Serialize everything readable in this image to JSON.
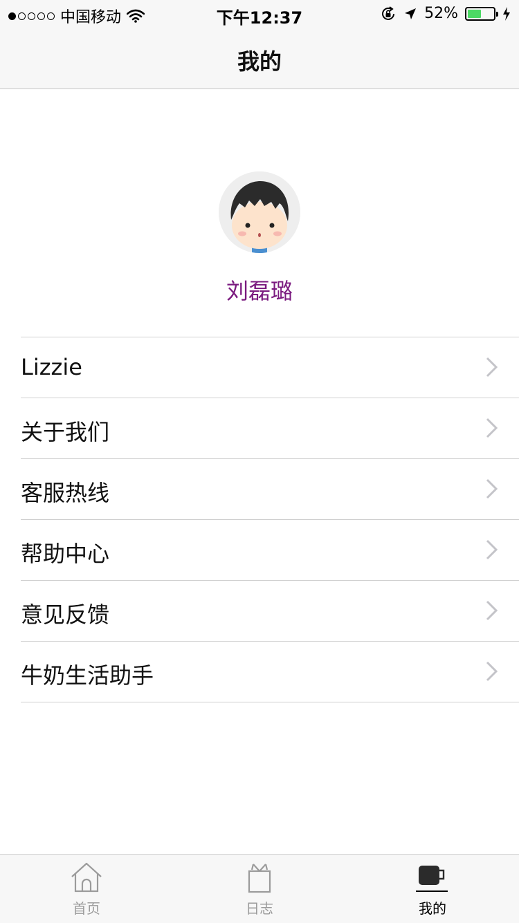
{
  "status_bar": {
    "carrier": "中国移动",
    "time": "下午12:37",
    "battery_percent": "52%",
    "battery_level": 0.52,
    "icons": [
      "signal-dots",
      "wifi-icon",
      "rotation-lock-icon",
      "location-arrow-icon",
      "battery-icon",
      "charging-bolt-icon"
    ]
  },
  "nav": {
    "title": "我的"
  },
  "profile": {
    "name": "刘磊璐",
    "avatar_icon": "cartoon-avatar"
  },
  "menu": {
    "items": [
      {
        "label": "Lizzie"
      },
      {
        "label": "关于我们"
      },
      {
        "label": "客服热线"
      },
      {
        "label": "帮助中心"
      },
      {
        "label": "意见反馈"
      },
      {
        "label": "牛奶生活助手"
      }
    ]
  },
  "tabbar": {
    "tabs": [
      {
        "label": "首页",
        "icon": "home-icon",
        "active": false
      },
      {
        "label": "日志",
        "icon": "gift-icon",
        "active": false
      },
      {
        "label": "我的",
        "icon": "cup-icon",
        "active": true
      }
    ]
  },
  "colors": {
    "accent_name": "#7a1a7f",
    "battery_fill": "#4cd964",
    "inactive_tab": "#9b9b9b",
    "active_tab": "#000000"
  }
}
